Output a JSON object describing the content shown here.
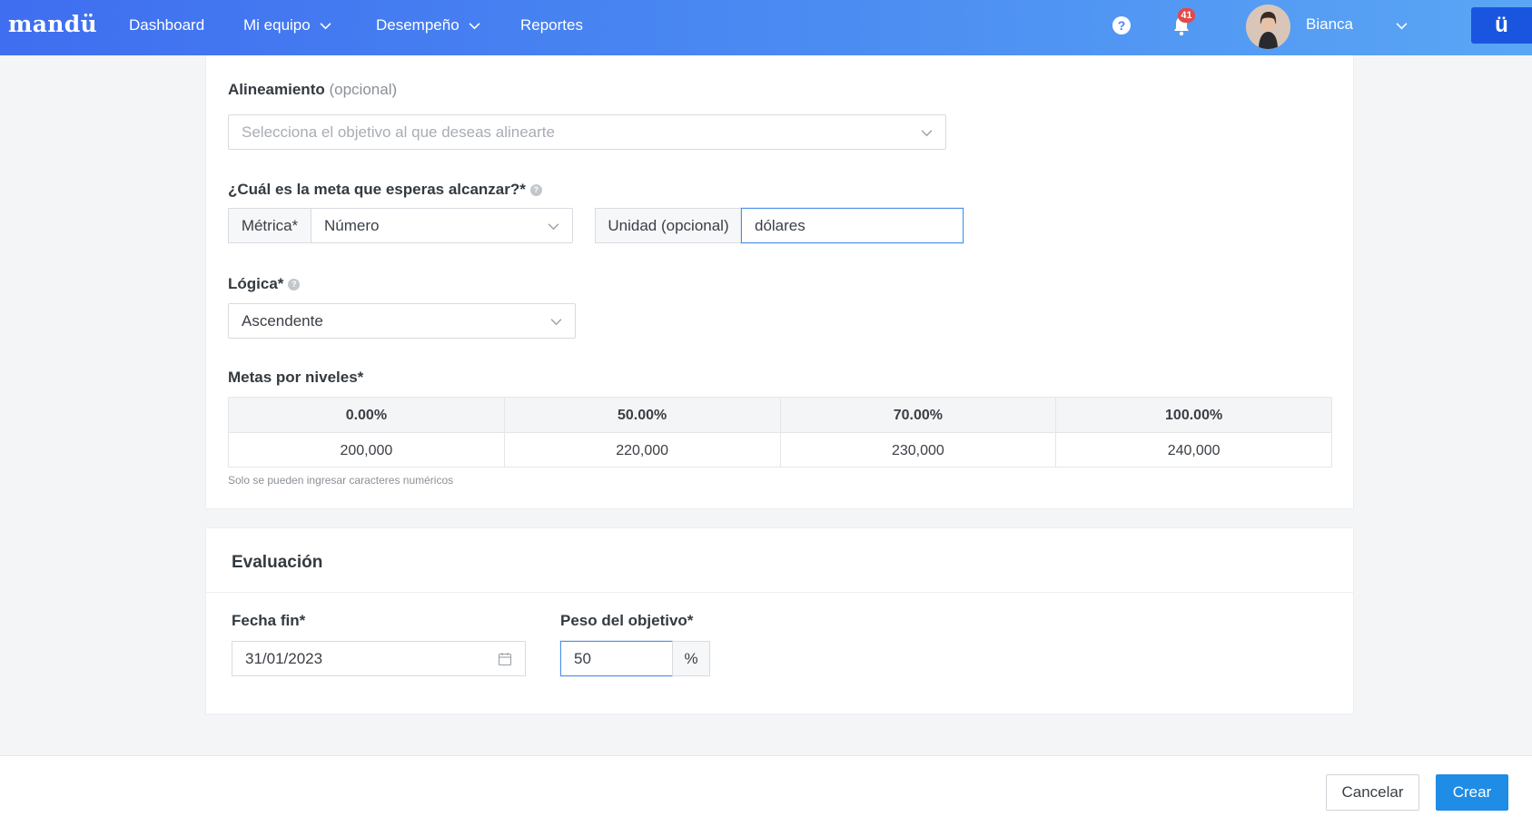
{
  "topbar": {
    "logo": "mandü",
    "nav": {
      "dashboard": "Dashboard",
      "mi_equipo": "Mi equipo",
      "desempeno": "Desempeño",
      "reportes": "Reportes"
    },
    "help": "?",
    "notifications_count": "41",
    "user_name": "Bianca",
    "brand_tile": "ü"
  },
  "alineamiento": {
    "label": "Alineamiento",
    "optional": "(opcional)",
    "placeholder": "Selecciona el objetivo al que deseas alinearte"
  },
  "meta": {
    "label": "¿Cuál es la meta que esperas alcanzar?*",
    "metrica_label": "Métrica*",
    "metrica_value": "Número",
    "unidad_label": "Unidad (opcional)",
    "unidad_value": "dólares"
  },
  "logica": {
    "label": "Lógica*",
    "value": "Ascendente"
  },
  "metas_niveles": {
    "label": "Metas por niveles*",
    "headers": [
      "0.00%",
      "50.00%",
      "70.00%",
      "100.00%"
    ],
    "values": [
      "200,000",
      "220,000",
      "230,000",
      "240,000"
    ],
    "hint": "Solo se pueden ingresar caracteres numéricos"
  },
  "evaluacion": {
    "title": "Evaluación",
    "fecha_label": "Fecha fin*",
    "fecha_value": "31/01/2023",
    "peso_label": "Peso del objetivo*",
    "peso_value": "50",
    "peso_unit": "%"
  },
  "footer": {
    "cancel": "Cancelar",
    "create": "Crear"
  },
  "colors": {
    "nav_gradient_start": "#3f6ef0",
    "nav_gradient_end": "#5aa6f5",
    "primary_button": "#1f8ce6",
    "badge": "#e54848"
  }
}
